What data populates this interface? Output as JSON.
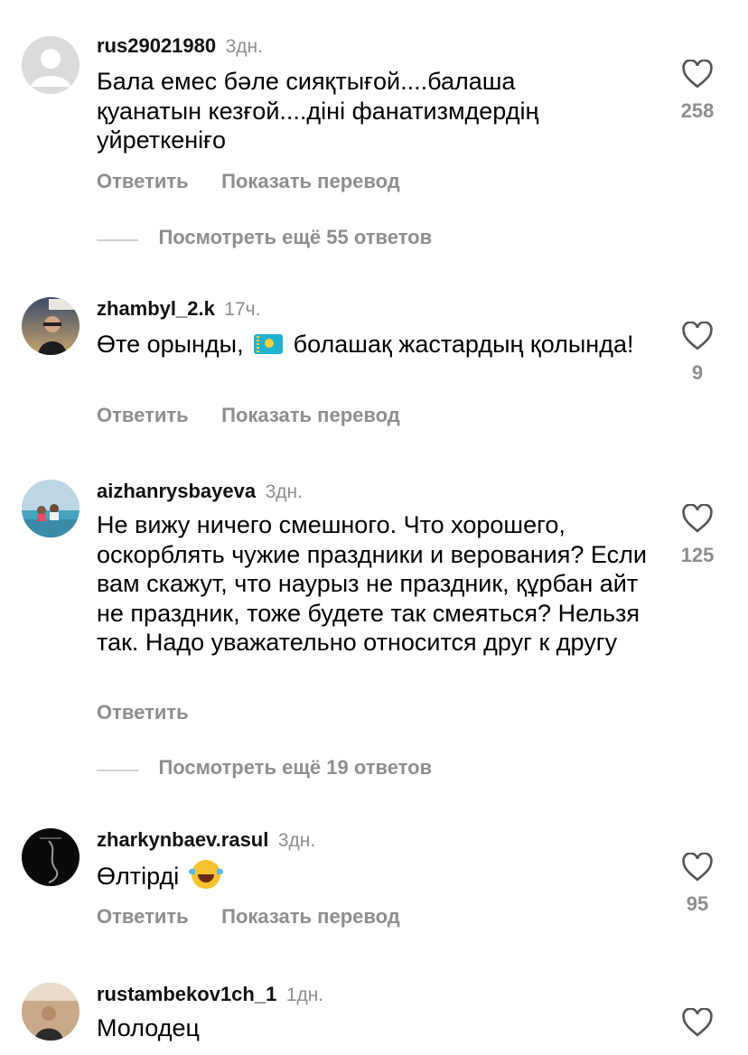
{
  "comments": [
    {
      "username": "rus29021980",
      "time": "3дн.",
      "text": "Бала емес бәле сияқтығой....балаша қуанатын кезғой....діні фанатизмдердің уйреткеніғо",
      "likes": "258",
      "reply_label": "Ответить",
      "translate_label": "Показать перевод",
      "view_replies": "Посмотреть ещё 55 ответов"
    },
    {
      "username": "zhambyl_2.k",
      "time": "17ч.",
      "text_before": "Өте орынды,",
      "text_after": "болашақ жастардың қолында!",
      "likes": "9",
      "reply_label": "Ответить",
      "translate_label": "Показать перевод"
    },
    {
      "username": "aizhanrysbayeva",
      "time": "3дн.",
      "text": "Не вижу ничего смешного. Что хорошего, оскорблять чужие праздники и верования? Если вам скажут, что наурыз не праздник, құрбан айт не праздник, тоже будете так смеяться? Нельзя так. Надо уважательно относится друг к другу",
      "likes": "125",
      "reply_label": "Ответить",
      "view_replies": "Посмотреть ещё 19 ответов"
    },
    {
      "username": "zharkynbaev.rasul",
      "time": "3дн.",
      "text": "Өлтірді",
      "likes": "95",
      "reply_label": "Ответить",
      "translate_label": "Показать перевод"
    },
    {
      "username": "rustambekov1ch_1",
      "time": "1дн.",
      "text": "Молодец"
    }
  ],
  "icons": {
    "like": "heart-icon",
    "flag": "kazakhstan-flag-emoji",
    "laugh": "tears-of-joy-emoji"
  }
}
